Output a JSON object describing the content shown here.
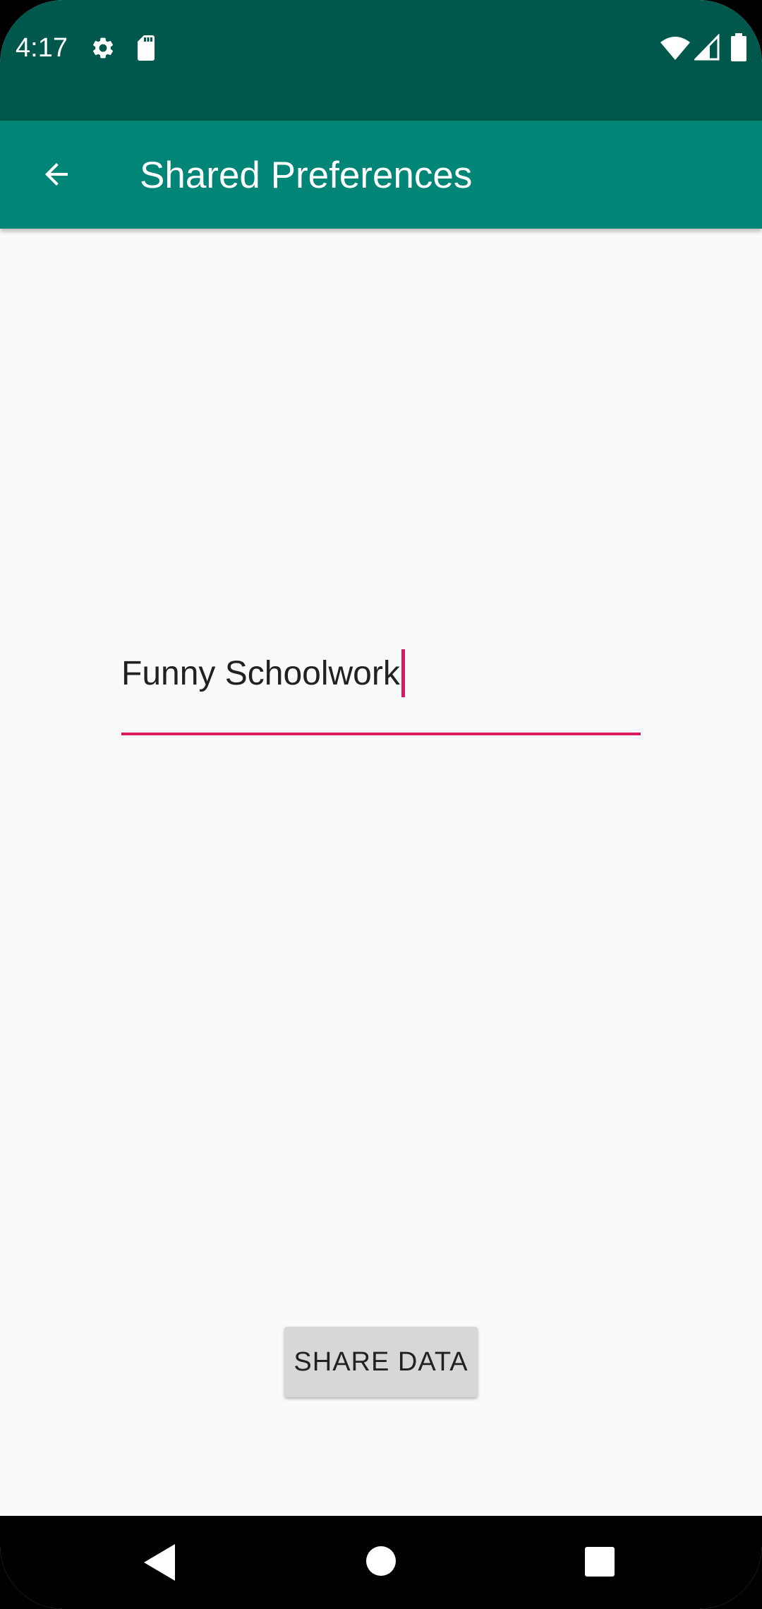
{
  "status_bar": {
    "time": "4:17",
    "icons": [
      "gear-icon",
      "sdcard-icon",
      "wifi-icon",
      "signal-icon",
      "battery-icon"
    ]
  },
  "app_bar": {
    "title": "Shared Preferences",
    "back_icon": "arrow-back-icon"
  },
  "main": {
    "edit_text_value": "Funny Schoolwork",
    "share_button_label": "SHARE DATA"
  },
  "nav_bar": {
    "icons": [
      "nav-back-icon",
      "nav-home-icon",
      "nav-recents-icon"
    ]
  },
  "colors": {
    "status_bar": "#00574b",
    "app_bar": "#008577",
    "accent": "#d81b60",
    "background": "#fafafa",
    "button": "#d6d7d7"
  }
}
